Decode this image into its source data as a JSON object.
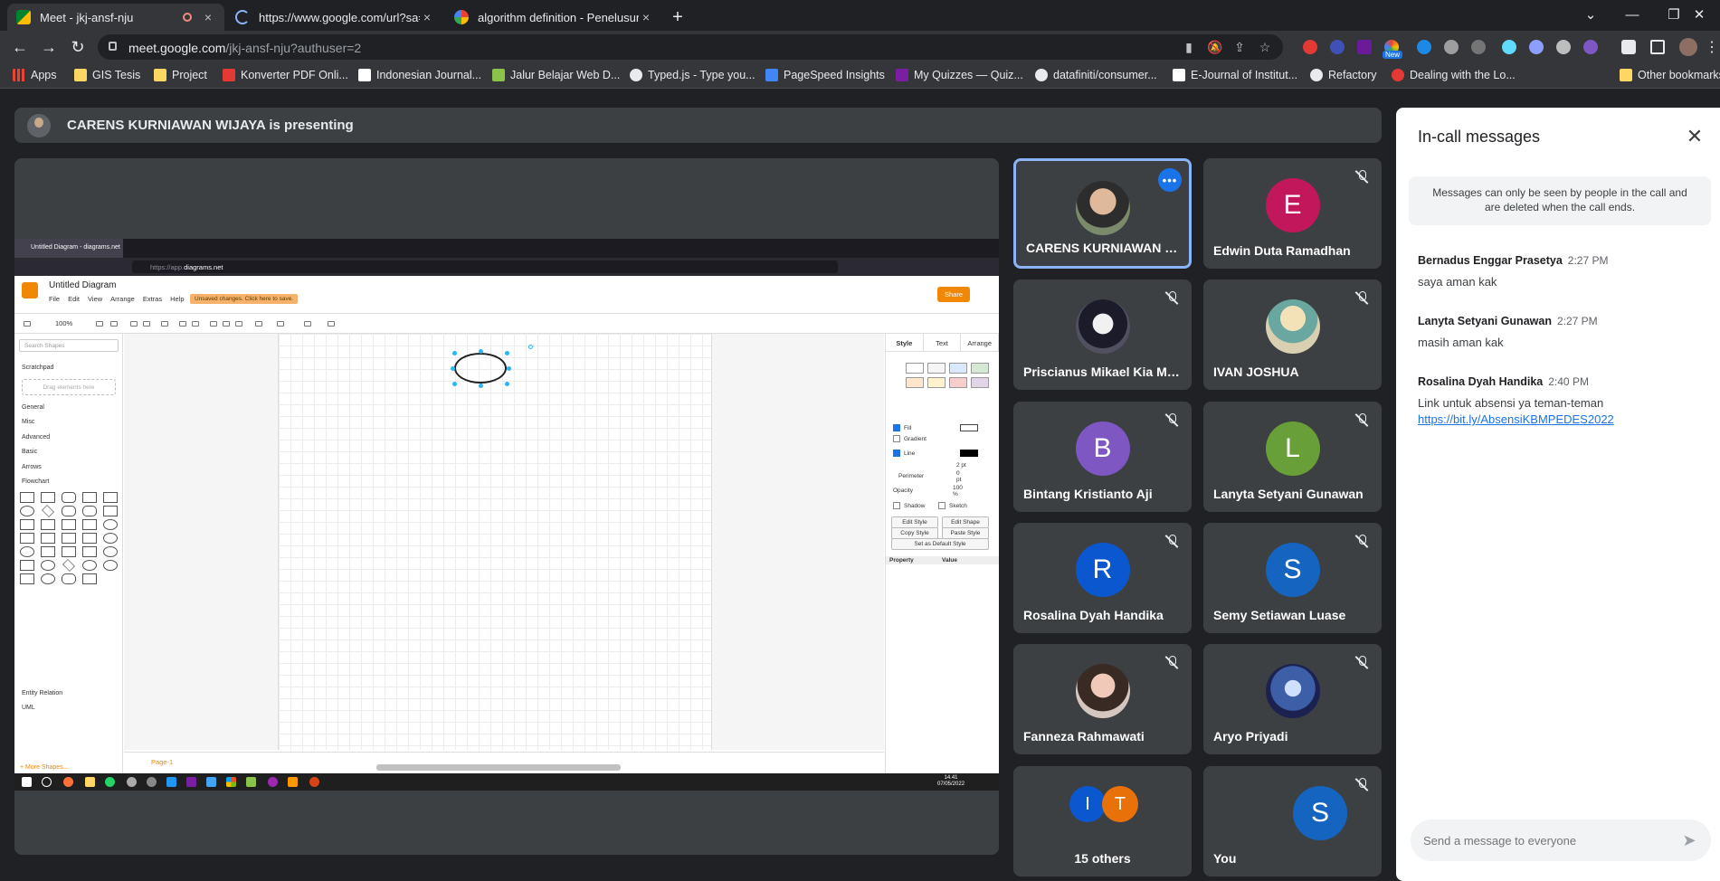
{
  "browser": {
    "tabs": [
      {
        "title": "Meet - jkj-ansf-nju",
        "close": "×"
      },
      {
        "title": "https://www.google.com/url?sa=",
        "close": "×"
      },
      {
        "title": "algorithm definition - Penelusura",
        "close": "×"
      }
    ],
    "new_tab": "+",
    "url_host": "meet.google.com",
    "url_path": "/jkj-ansf-nju?authuser=2",
    "bookmarks": [
      "Apps",
      "GIS Tesis",
      "Project",
      "Konverter PDF Onli...",
      "Indonesian Journal...",
      "Jalur Belajar Web D...",
      "Typed.js - Type you...",
      "PageSpeed Insights",
      "My Quizzes — Quiz...",
      "datafiniti/consumer...",
      "E-Journal of Institut...",
      "Refactory",
      "Dealing with the Lo...",
      "Other bookmarks"
    ],
    "extension_badge": "New"
  },
  "meet": {
    "presenting_text": "CARENS KURNIAWAN WIJAYA is presenting",
    "shared_screen": {
      "ff_tab": "Untitled Diagram - diagrams.net",
      "ff_url_dim": "https://app.",
      "ff_url_host": "diagrams.net",
      "title": "Untitled Diagram",
      "menu": [
        "File",
        "Edit",
        "View",
        "Arrange",
        "Extras",
        "Help"
      ],
      "unsaved": "Unsaved changes. Click here to save.",
      "share": "Share",
      "zoom": "100%",
      "search": "Search Shapes",
      "scratchpad": "Scratchpad",
      "drag_here": "Drag elements here",
      "sections": [
        "General",
        "Misc",
        "Advanced",
        "Basic",
        "Arrows",
        "Flowchart"
      ],
      "sections_after": [
        "Entity Relation",
        "UML"
      ],
      "more_shapes": "+ More Shapes...",
      "page_tab": "Page-1",
      "format_tabs": [
        "Style",
        "Text",
        "Arrange"
      ],
      "fill": "Fill",
      "gradient": "Gradient",
      "line": "Line",
      "line_pt": "2 pt",
      "perimeter": "Perimeter",
      "perimeter_pt": "0 pt",
      "opacity": "Opacity",
      "opacity_val": "100 %",
      "shadow": "Shadow",
      "sketch": "Sketch",
      "edit_style": "Edit Style",
      "edit_shape": "Edit Shape",
      "copy_style": "Copy Style",
      "paste_style": "Paste Style",
      "set_default": "Set as Default Style",
      "property": "Property",
      "value": "Value",
      "clock_time": "14.41",
      "clock_date": "07/05/2022"
    },
    "participants": [
      {
        "name": "CARENS KURNIAWAN W...",
        "initial": "",
        "color": ""
      },
      {
        "name": "Edwin Duta Ramadhan",
        "initial": "E",
        "color": "#c2185b"
      },
      {
        "name": "Priscianus Mikael Kia Ma...",
        "initial": "",
        "color": ""
      },
      {
        "name": "IVAN JOSHUA",
        "initial": "",
        "color": ""
      },
      {
        "name": "Bintang Kristianto Aji",
        "initial": "B",
        "color": "#7e57c2"
      },
      {
        "name": "Lanyta Setyani Gunawan",
        "initial": "L",
        "color": "#689f38"
      },
      {
        "name": "Rosalina Dyah Handika",
        "initial": "R",
        "color": "#0b57d0"
      },
      {
        "name": "Semy Setiawan Luase",
        "initial": "S",
        "color": "#1565c0"
      },
      {
        "name": "Fanneza Rahmawati",
        "initial": "",
        "color": ""
      },
      {
        "name": "Aryo Priyadi",
        "initial": "",
        "color": ""
      },
      {
        "name": "15 others",
        "initial": "",
        "color": ""
      },
      {
        "name": "You",
        "initial": "S",
        "color": "#1565c0"
      }
    ],
    "others_avatars": [
      {
        "initial": "I",
        "color": "#0b57d0"
      },
      {
        "initial": "T",
        "color": "#e8710a"
      }
    ]
  },
  "chat": {
    "title": "In-call messages",
    "note": "Messages can only be seen by people in the call and are deleted when the call ends.",
    "messages": [
      {
        "sender": "Bernadus Enggar Prasetya",
        "time": "2:27 PM",
        "text": "saya aman kak",
        "link": ""
      },
      {
        "sender": "Lanyta Setyani Gunawan",
        "time": "2:27 PM",
        "text": "masih aman kak",
        "link": ""
      },
      {
        "sender": "Rosalina Dyah Handika",
        "time": "2:40 PM",
        "text": "Link untuk absensi ya teman-teman",
        "link": "https://bit.ly/AbsensiKBMPEDES2022"
      }
    ],
    "input_placeholder": "Send a message to everyone"
  }
}
